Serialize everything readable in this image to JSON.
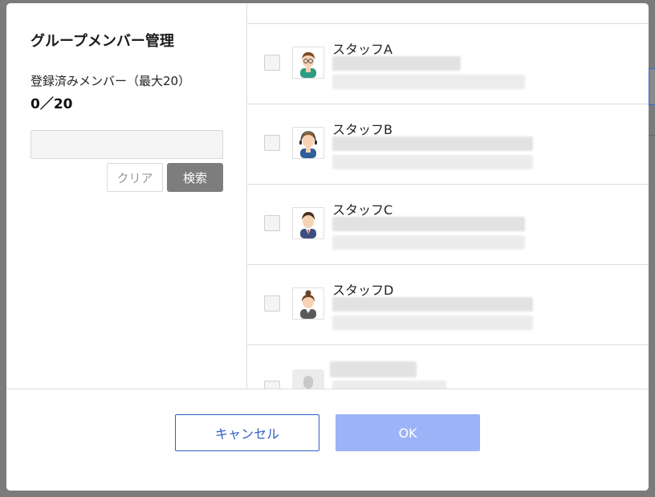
{
  "dialog": {
    "title": "グループメンバー管理",
    "member_label": "登録済みメンバー（最大20）",
    "member_count": "0／20"
  },
  "search": {
    "value": "",
    "placeholder": "",
    "clear_label": "クリア",
    "search_label": "検索"
  },
  "members": [
    {
      "name": "スタッフA",
      "avatar": "staff-glasses-avatar"
    },
    {
      "name": "スタッフB",
      "avatar": "staff-headset-avatar"
    },
    {
      "name": "スタッフC",
      "avatar": "staff-suit-avatar"
    },
    {
      "name": "スタッフD",
      "avatar": "staff-woman-avatar"
    }
  ],
  "footer": {
    "cancel_label": "キャンセル",
    "ok_label": "OK"
  },
  "colors": {
    "accent": "#2f5fc4",
    "ok_disabled": "#9bb4f7",
    "search_button": "#7d7d7d",
    "overlay": "#7b7b7b"
  }
}
